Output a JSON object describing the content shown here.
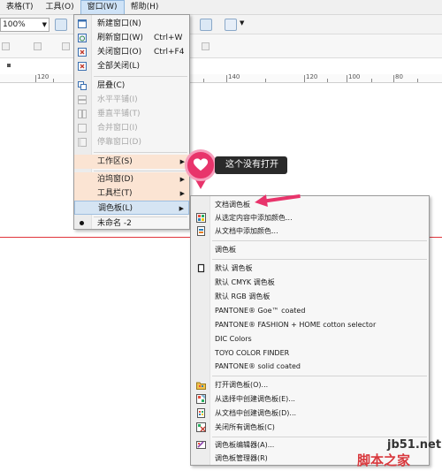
{
  "menubar": {
    "items": [
      "表格(T)",
      "工具(O)",
      "窗口(W)",
      "帮助(H)"
    ]
  },
  "toolbar": {
    "zoom": "100%"
  },
  "ruler": {
    "labels": [
      "120",
      "140",
      "120",
      "100",
      "80"
    ]
  },
  "window_menu": {
    "items": [
      {
        "label": "新建窗口(N)",
        "shortcut": ""
      },
      {
        "label": "刷新窗口(W)",
        "shortcut": "Ctrl+W"
      },
      {
        "label": "关闭窗口(O)",
        "shortcut": "Ctrl+F4"
      },
      {
        "label": "全部关闭(L)",
        "shortcut": ""
      },
      {
        "label": "层叠(C)",
        "shortcut": ""
      },
      {
        "label": "水平平铺(I)",
        "shortcut": ""
      },
      {
        "label": "垂直平铺(T)",
        "shortcut": ""
      },
      {
        "label": "合并窗口(I)",
        "shortcut": ""
      },
      {
        "label": "停靠窗口(D)",
        "shortcut": ""
      },
      {
        "label": "工作区(S)",
        "shortcut": ""
      },
      {
        "label": "泊坞窗(D)",
        "shortcut": ""
      },
      {
        "label": "工具栏(T)",
        "shortcut": ""
      },
      {
        "label": "调色板(L)",
        "shortcut": ""
      },
      {
        "label": "未命名 -2",
        "shortcut": ""
      }
    ]
  },
  "palette_menu": {
    "items": [
      "文档调色板",
      "从选定内容中添加颜色...",
      "从文档中添加颜色...",
      "调色板",
      "默认 调色板",
      "默认 CMYK 调色板",
      "默认 RGB 调色板",
      "PANTONE® Goe™ coated",
      "PANTONE® FASHION + HOME cotton selector",
      "DIC Colors",
      "TOYO COLOR FINDER",
      "PANTONE® solid coated",
      "打开调色板(O)...",
      "从选择中创建调色板(E)...",
      "从文档中创建调色板(D)...",
      "关闭所有调色板(C)",
      "调色板编辑器(A)...",
      "调色板管理器(R)"
    ]
  },
  "callout": {
    "text": "这个没有打开"
  },
  "watermark": {
    "site": "jb51.net",
    "brand": "脚本之家"
  },
  "colors": {
    "accent": "#e8346b",
    "highlight": "#fbe4d3",
    "selection": "#d5e4f3",
    "guide_line": "#e0353c"
  }
}
